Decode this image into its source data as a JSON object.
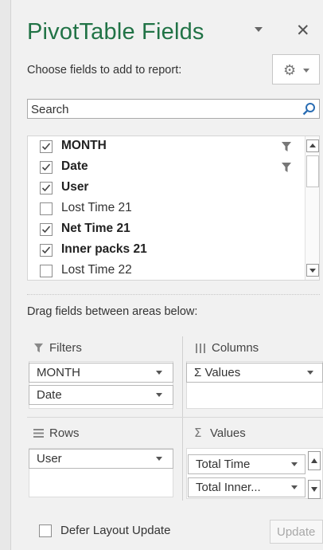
{
  "title": "PivotTable Fields",
  "choose_label": "Choose fields to add to report:",
  "search": {
    "placeholder": "Search",
    "value": ""
  },
  "fields": [
    {
      "label": "MONTH",
      "checked": true,
      "bold": true,
      "filtered": true
    },
    {
      "label": "Date",
      "checked": true,
      "bold": true,
      "filtered": true
    },
    {
      "label": "User",
      "checked": true,
      "bold": true,
      "filtered": false
    },
    {
      "label": "Lost Time 21",
      "checked": false,
      "bold": false,
      "filtered": false
    },
    {
      "label": "Net Time 21",
      "checked": true,
      "bold": true,
      "filtered": false
    },
    {
      "label": "Inner packs 21",
      "checked": true,
      "bold": true,
      "filtered": false
    },
    {
      "label": "Lost Time 22",
      "checked": false,
      "bold": false,
      "filtered": false
    }
  ],
  "drag_label": "Drag fields between areas below:",
  "areas": {
    "filters": {
      "label": "Filters",
      "items": [
        "MONTH",
        "Date"
      ]
    },
    "columns": {
      "label": "Columns",
      "items": [
        "Σ Values"
      ]
    },
    "rows": {
      "label": "Rows",
      "items": [
        "User"
      ]
    },
    "values": {
      "label": "Values",
      "items": [
        "Total Time",
        "Total Inner..."
      ]
    }
  },
  "defer_label": "Defer Layout Update",
  "update_label": "Update",
  "icons": {
    "gear": "gear-icon",
    "search": "magnifier-icon",
    "filter": "funnel-icon",
    "columns": "columns-icon",
    "rows": "rows-icon",
    "values": "sigma-icon"
  },
  "colors": {
    "title": "#217346",
    "checkbox_border": "#8c8c8c"
  }
}
